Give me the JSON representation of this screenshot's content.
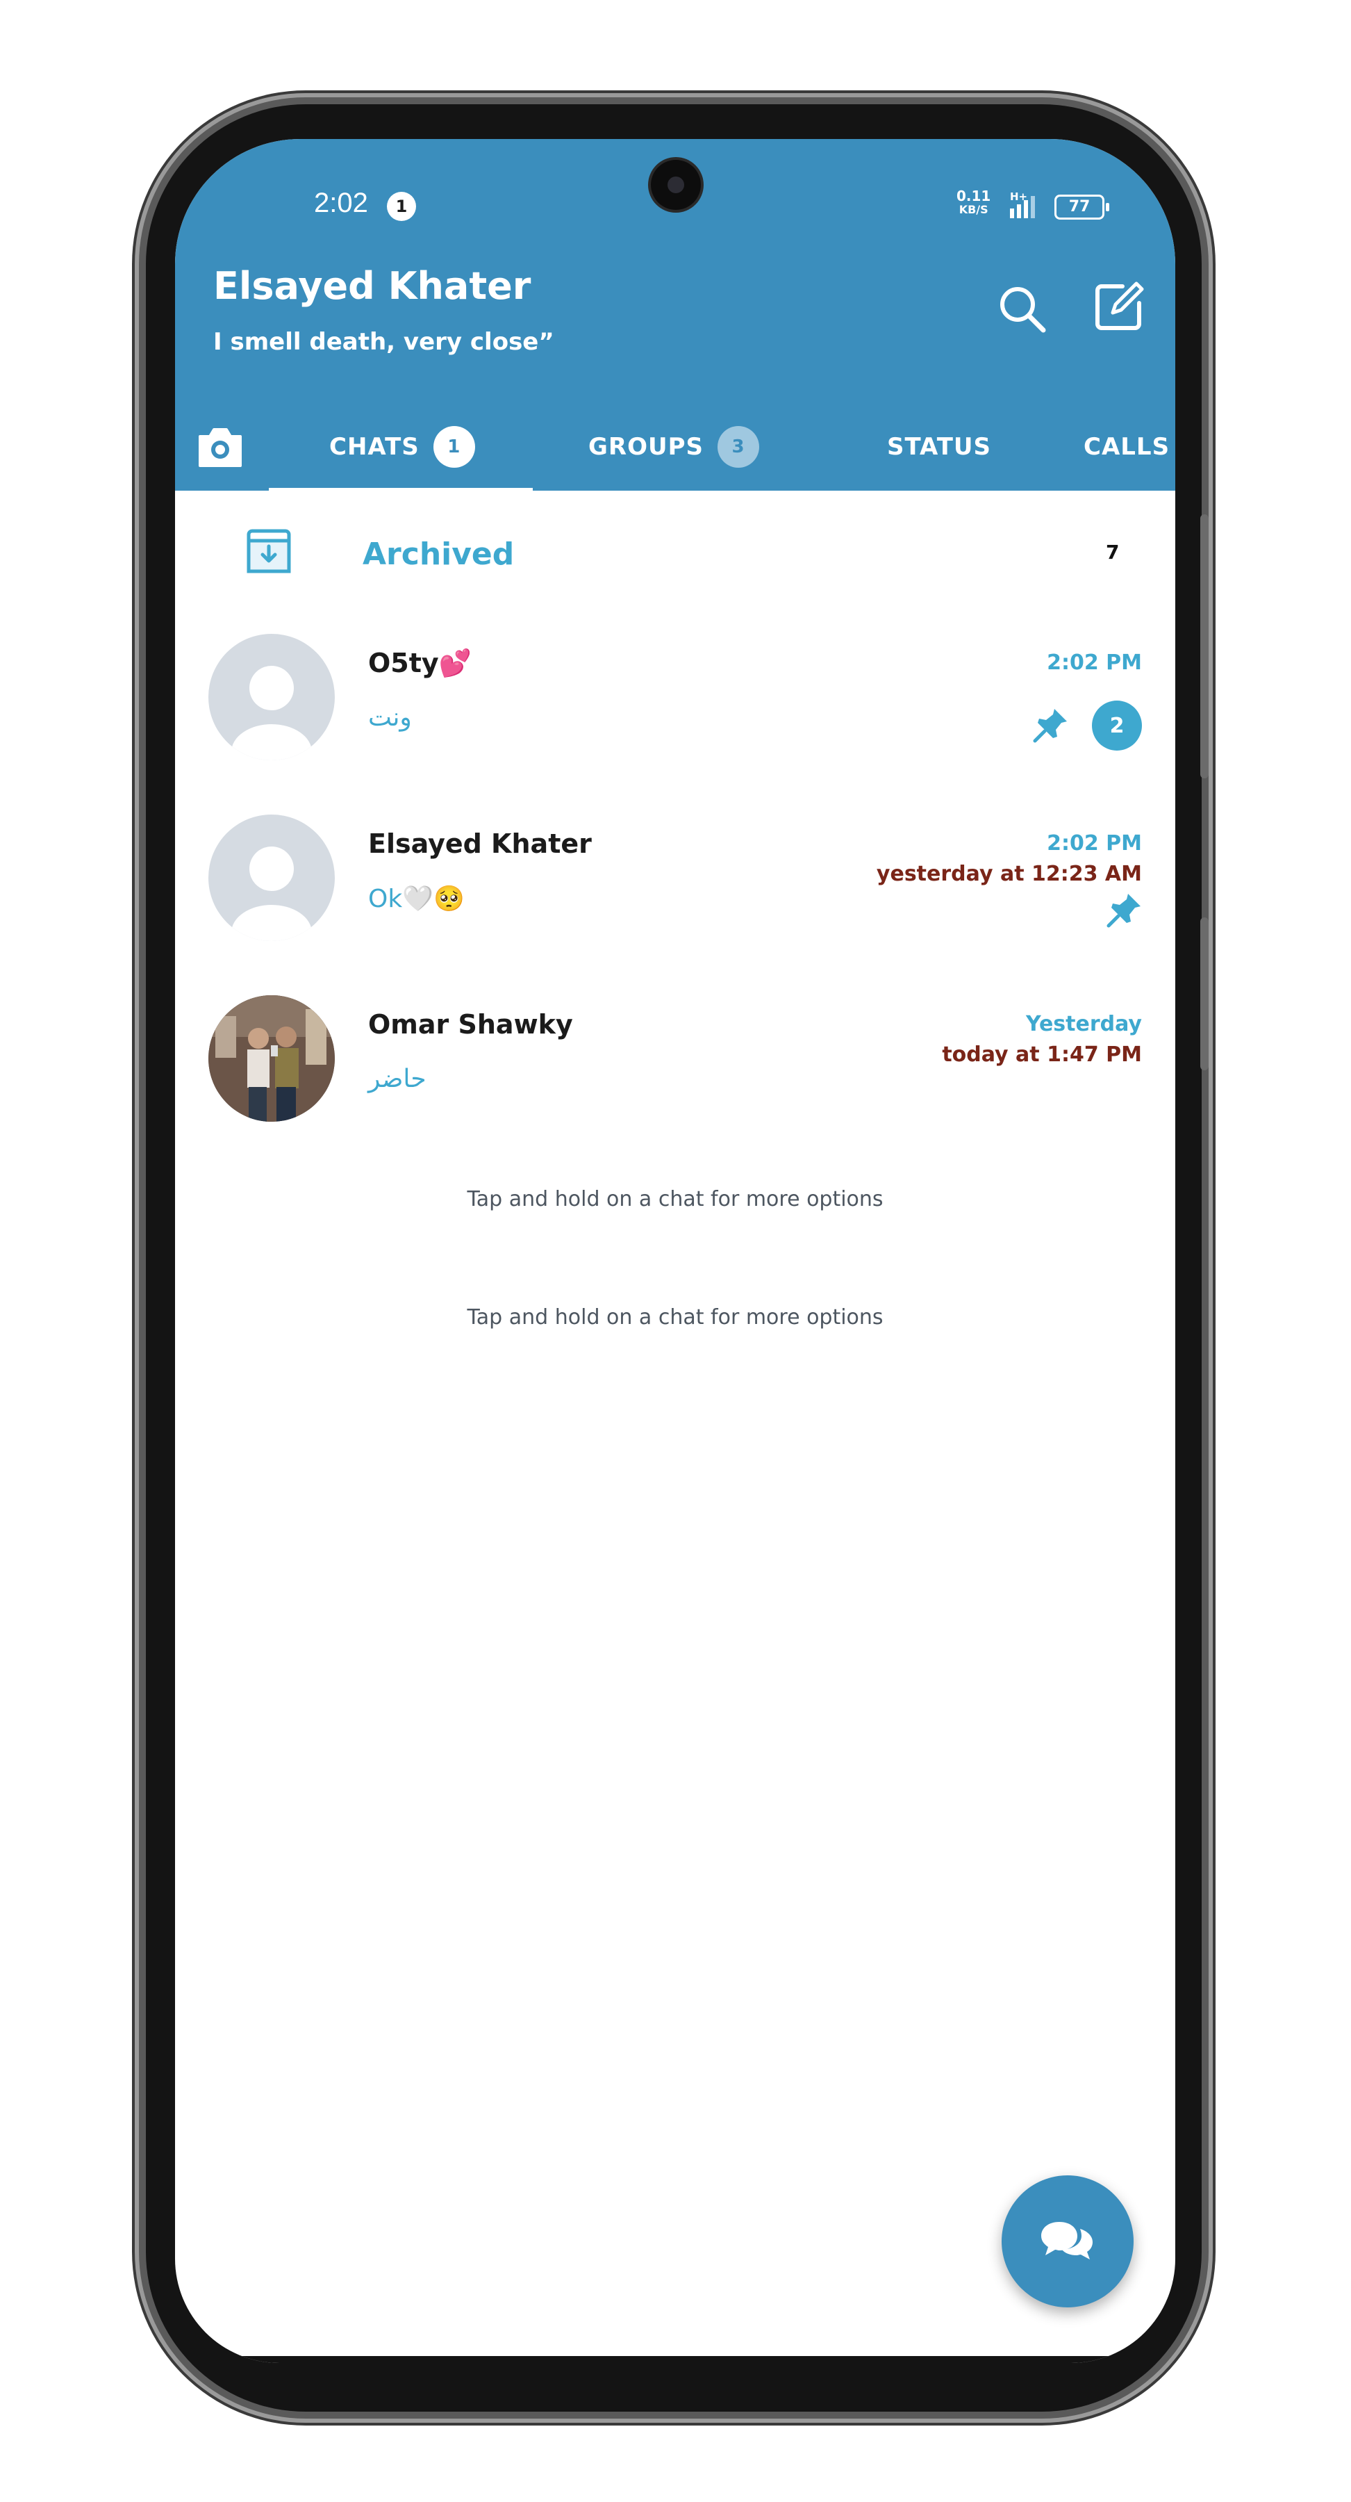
{
  "status_bar": {
    "time": "2:02",
    "notification_count": "1",
    "net_speed_value": "0.11",
    "net_speed_unit": "KB/S",
    "network_type": "H+",
    "battery": "77"
  },
  "header": {
    "title": "Elsayed Khater",
    "subtitle": "I smell death, very close”"
  },
  "tabs": [
    {
      "label": "CHATS",
      "badge": "1"
    },
    {
      "label": "GROUPS",
      "badge": "3"
    },
    {
      "label": "STATUS"
    },
    {
      "label": "CALLS"
    }
  ],
  "archived": {
    "label": "Archived",
    "count": "7"
  },
  "chats": [
    {
      "name": "O5ty💕",
      "preview": "ونت",
      "time": "2:02 PM",
      "pinned": true,
      "unread": "2"
    },
    {
      "name": "Elsayed Khater",
      "preview": "Ok🤍🥺",
      "time": "2:02 PM",
      "last_seen": "yesterday at 12:23 AM",
      "pinned": true
    },
    {
      "name": "Omar Shawky",
      "preview": "حاضر",
      "time": "Yesterday",
      "last_seen": "today at 1:47 PM",
      "pinned": false
    }
  ],
  "hints": [
    "Tap and hold on a chat for more options",
    "Tap and hold on a chat for more options"
  ],
  "colors": {
    "header": "#3b8ebd",
    "accent": "#3ea8cf",
    "last_seen": "#7a2518"
  },
  "icons": {
    "search": "search-icon",
    "compose": "compose-icon",
    "camera": "camera-icon",
    "archive": "archive-icon",
    "pin": "pin-icon",
    "fab": "chat-bubbles-icon"
  }
}
